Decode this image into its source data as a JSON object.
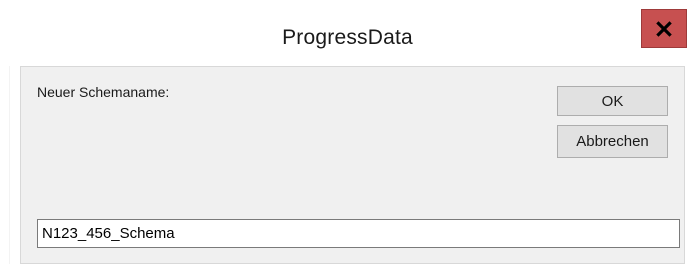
{
  "window": {
    "title": "ProgressData",
    "close_icon": "close-icon"
  },
  "dialog": {
    "prompt_label": "Neuer Schemaname:",
    "ok_label": "OK",
    "cancel_label": "Abbrechen",
    "schema_name_value": "N123_456_Schema"
  },
  "colors": {
    "close_button": "#c75050",
    "client_background": "#f0f0f0",
    "button_face": "#e1e1e1"
  }
}
